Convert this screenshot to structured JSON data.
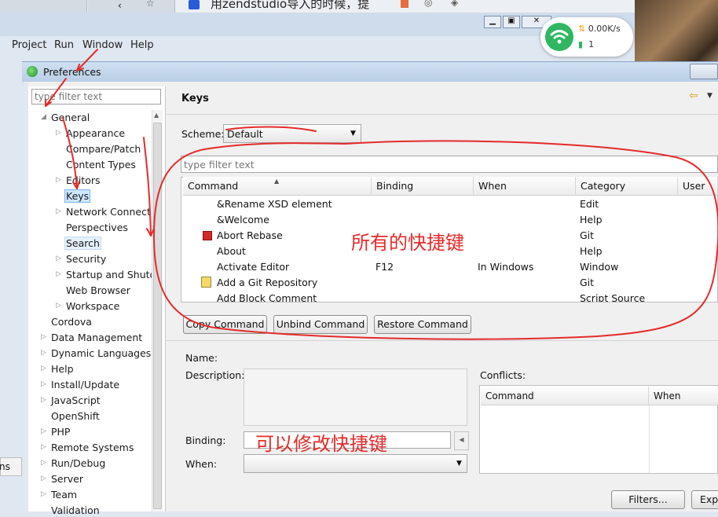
{
  "browser": {
    "tab_title": "用zendstudio导入的时候，提"
  },
  "eclipse_menu": [
    "Project",
    "Run",
    "Window",
    "Help"
  ],
  "net_widget": {
    "speed": "0.00K/s",
    "count": "1",
    "colors": {
      "wifi": "#2eb760"
    }
  },
  "window": {
    "title": "Preferences"
  },
  "left": {
    "filter_placeholder": "type filter text",
    "tree": [
      {
        "label": "General",
        "level": 0,
        "expander": "▲"
      },
      {
        "label": "Appearance",
        "level": 1,
        "expander": "▷"
      },
      {
        "label": "Compare/Patch",
        "level": 1,
        "expander": ""
      },
      {
        "label": "Content Types",
        "level": 1,
        "expander": ""
      },
      {
        "label": "Editors",
        "level": 1,
        "expander": "▷"
      },
      {
        "label": "Keys",
        "level": 1,
        "expander": "",
        "selected": true
      },
      {
        "label": "Network Connectio",
        "level": 1,
        "expander": "▷"
      },
      {
        "label": "Perspectives",
        "level": 1,
        "expander": ""
      },
      {
        "label": "Search",
        "level": 1,
        "expander": "",
        "highlighted": true
      },
      {
        "label": "Security",
        "level": 1,
        "expander": "▷"
      },
      {
        "label": "Startup and Shutd",
        "level": 1,
        "expander": "▷"
      },
      {
        "label": "Web Browser",
        "level": 1,
        "expander": ""
      },
      {
        "label": "Workspace",
        "level": 1,
        "expander": "▷"
      },
      {
        "label": "Cordova",
        "level": 0,
        "expander": ""
      },
      {
        "label": "Data Management",
        "level": 0,
        "expander": "▷"
      },
      {
        "label": "Dynamic Languages",
        "level": 0,
        "expander": "▷"
      },
      {
        "label": "Help",
        "level": 0,
        "expander": "▷"
      },
      {
        "label": "Install/Update",
        "level": 0,
        "expander": "▷"
      },
      {
        "label": "JavaScript",
        "level": 0,
        "expander": "▷"
      },
      {
        "label": "OpenShift",
        "level": 0,
        "expander": ""
      },
      {
        "label": "PHP",
        "level": 0,
        "expander": "▷"
      },
      {
        "label": "Remote Systems",
        "level": 0,
        "expander": "▷"
      },
      {
        "label": "Run/Debug",
        "level": 0,
        "expander": "▷"
      },
      {
        "label": "Server",
        "level": 0,
        "expander": "▷"
      },
      {
        "label": "Team",
        "level": 0,
        "expander": "▷"
      },
      {
        "label": "Validation",
        "level": 0,
        "expander": ""
      }
    ]
  },
  "right": {
    "heading": "Keys",
    "scheme_label": "Scheme:",
    "scheme_value": "Default",
    "filter_placeholder": "type filter text",
    "columns": [
      "Command",
      "Binding",
      "When",
      "Category",
      "User"
    ],
    "rows": [
      {
        "icon": "",
        "command": "&Rename XSD element",
        "binding": "",
        "when": "",
        "category": "Edit"
      },
      {
        "icon": "",
        "command": "&Welcome",
        "binding": "",
        "when": "",
        "category": "Help"
      },
      {
        "icon": "stop-icon",
        "command": "Abort Rebase",
        "binding": "",
        "when": "",
        "category": "Git"
      },
      {
        "icon": "",
        "command": "About",
        "binding": "",
        "when": "",
        "category": "Help"
      },
      {
        "icon": "",
        "command": "Activate Editor",
        "binding": "F12",
        "when": "In Windows",
        "category": "Window"
      },
      {
        "icon": "git-repo-icon",
        "command": "Add a Git Repository",
        "binding": "",
        "when": "",
        "category": "Git"
      },
      {
        "icon": "",
        "command": "Add Block Comment",
        "binding": "",
        "when": "",
        "category": "Script Source"
      }
    ],
    "buttons": {
      "copy": "Copy Command",
      "unbind": "Unbind Command",
      "restore": "Restore Command"
    },
    "name_label": "Name:",
    "description_label": "Description:",
    "binding_label": "Binding:",
    "when_label": "When:",
    "conflicts_label": "Conflicts:",
    "conflicts_columns": [
      "Command",
      "When"
    ],
    "filters_button": "Filters...",
    "export_button": "Expo"
  },
  "annotations": {
    "all_shortcuts": "所有的快捷键",
    "edit_shortcut": "可以修改快捷键",
    "color": "#e52a2a"
  }
}
